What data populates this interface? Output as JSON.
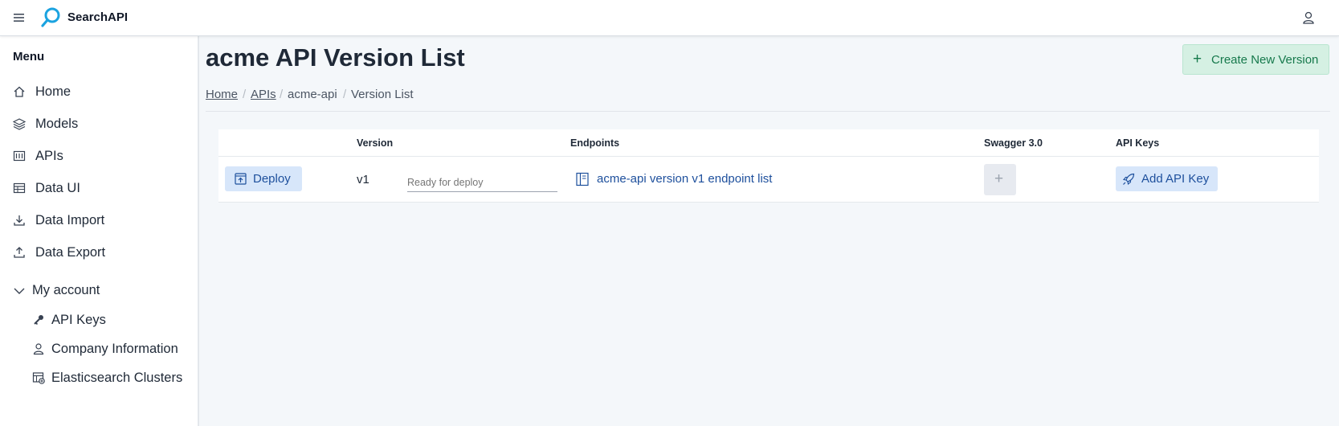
{
  "app": {
    "brand": "SearchAPI"
  },
  "icons": {
    "menu": "hamburger-icon",
    "logo": "search-icon",
    "user": "user-icon",
    "home": "home-icon",
    "models": "layers-icon",
    "apis": "api-icon",
    "data_ui": "table-icon",
    "data_import": "download-icon",
    "data_export": "upload-icon",
    "account": "chevron-down-icon",
    "api_keys": "key-icon",
    "company": "user-icon",
    "clusters": "cluster-icon",
    "deploy": "deploy-icon",
    "endpoints": "book-icon",
    "add": "plus-icon",
    "add_key": "rocket-icon"
  },
  "colors": {
    "accent": "#1d4f9c",
    "accent_bg": "#d7e6fa",
    "create_bg": "#d5f0e3",
    "create_text": "#16794c"
  },
  "sidebar": {
    "menu_title": "Menu",
    "items": [
      {
        "label": "Home"
      },
      {
        "label": "Models"
      },
      {
        "label": "APIs"
      },
      {
        "label": "Data UI"
      },
      {
        "label": "Data Import"
      },
      {
        "label": "Data Export"
      }
    ],
    "account": {
      "label": "My account",
      "items": [
        {
          "label": "API Keys"
        },
        {
          "label": "Company Information"
        },
        {
          "label": "Elasticsearch Clusters"
        }
      ]
    }
  },
  "page": {
    "title": "acme API Version List",
    "create_button": "Create New Version",
    "breadcrumb": [
      "Home",
      "APIs",
      "acme-api",
      "Version List"
    ],
    "breadcrumb_sep": "/"
  },
  "table": {
    "headers": [
      "",
      "Version",
      "Endpoints",
      "Swagger 3.0",
      "API Keys"
    ],
    "rows": [
      {
        "deploy_label": "Deploy",
        "version": "v1",
        "status_placeholder": "Ready for deploy",
        "endpoint_label": "acme-api version v1 endpoint list",
        "swagger_add": "+",
        "apikey_label": "Add API Key"
      }
    ]
  }
}
